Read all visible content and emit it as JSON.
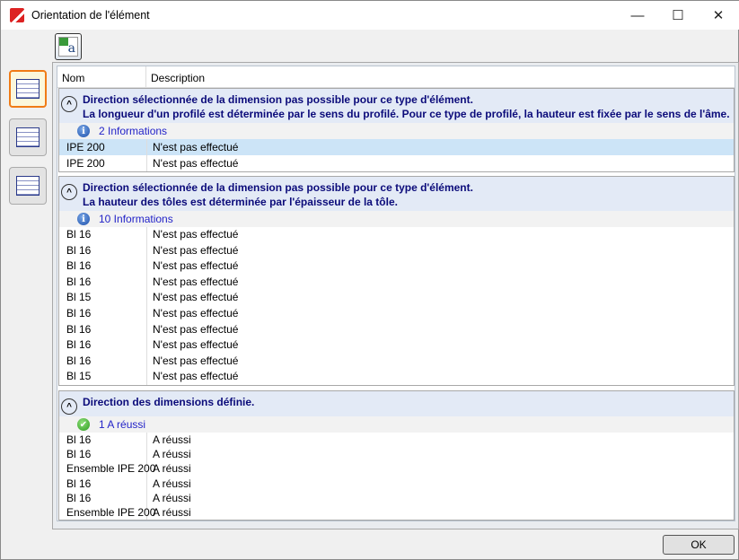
{
  "window": {
    "title": "Orientation de l'élément",
    "minimize": "—",
    "maximize": "☐",
    "close": "✕"
  },
  "toolbar": {
    "export_icon": "excel-export-icon"
  },
  "sidebar": [
    {
      "icon": "list-view-colored-icon",
      "selected": true
    },
    {
      "icon": "list-view-icon",
      "selected": false
    },
    {
      "icon": "table-view-icon",
      "selected": false
    }
  ],
  "columns": {
    "name": "Nom",
    "description": "Description"
  },
  "groups": [
    {
      "title_lines": [
        "Direction sélectionnée de la dimension pas possible pour ce type d'élément.",
        "La longueur d'un profilé est déterminée par le sens du profilé. Pour ce type de profilé, la hauteur est fixée par le sens de l'âme."
      ],
      "status": "2 Informations",
      "status_icon": "info-icon",
      "rows": [
        [
          "IPE 200",
          "N'est pas effectué"
        ],
        [
          "IPE 200",
          "N'est pas effectué"
        ]
      ]
    },
    {
      "title_lines": [
        "Direction sélectionnée de la dimension pas possible pour ce type d'élément.",
        "La hauteur des tôles est déterminée par l'épaisseur de la tôle."
      ],
      "status": "10 Informations",
      "status_icon": "info-icon",
      "rows": [
        [
          "Bl 16",
          "N'est pas effectué"
        ],
        [
          "Bl 16",
          "N'est pas effectué"
        ],
        [
          "Bl 16",
          "N'est pas effectué"
        ],
        [
          "Bl 16",
          "N'est pas effectué"
        ],
        [
          "Bl 15",
          "N'est pas effectué"
        ],
        [
          "Bl 16",
          "N'est pas effectué"
        ],
        [
          "Bl 16",
          "N'est pas effectué"
        ],
        [
          "Bl 16",
          "N'est pas effectué"
        ],
        [
          "Bl 16",
          "N'est pas effectué"
        ],
        [
          "Bl 15",
          "N'est pas effectué"
        ]
      ]
    },
    {
      "title_lines": [
        "Direction des dimensions définie."
      ],
      "status": "1 A réussi",
      "status_icon": "success-check-icon",
      "rows": [
        [
          "Bl 16",
          "A réussi"
        ],
        [
          "Bl 16",
          "A réussi"
        ],
        [
          "Ensemble IPE 200",
          "A réussi"
        ],
        [
          "Bl 16",
          "A réussi"
        ],
        [
          "Bl 16",
          "A réussi"
        ],
        [
          "Ensemble IPE 200",
          "A réussi"
        ]
      ]
    }
  ],
  "footer": {
    "ok_label": "OK"
  }
}
